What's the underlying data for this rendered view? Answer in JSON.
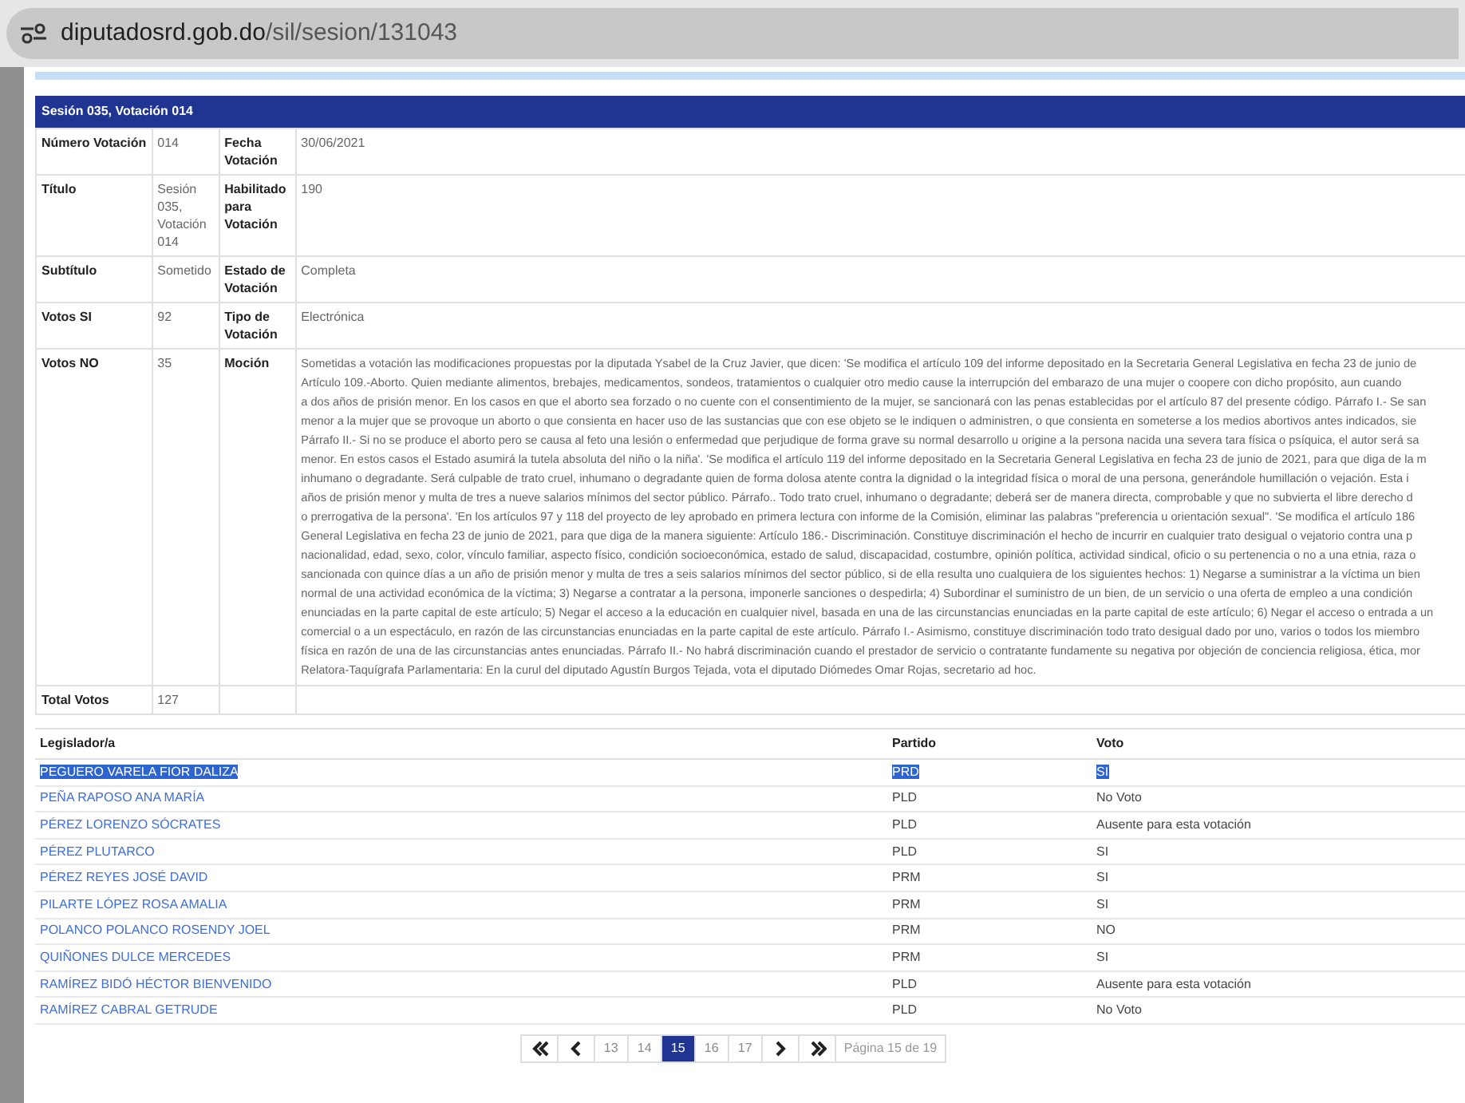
{
  "browser": {
    "url_domain": "diputadosrd.gob.do",
    "url_path": "/sil/sesion/131043"
  },
  "panel": {
    "title": "Sesión 035, Votación 014"
  },
  "details": [
    {
      "label": "Número Votación",
      "value": "014",
      "label_2": "Fecha Votación",
      "value_2": "30/06/2021"
    },
    {
      "label": "Título",
      "value": "Sesión 035, Votación 014",
      "label_2": "Habilitado para Votación",
      "value_2": "190"
    },
    {
      "label": "Subtítulo",
      "value": "Sometido",
      "label_2": "Estado de Votación",
      "value_2": "Completa"
    },
    {
      "label": "Votos SI",
      "value": "92",
      "label_2": "Tipo de Votación",
      "value_2": "Electrónica"
    },
    {
      "label": "Votos NO",
      "value": "35",
      "label_2": "Moción",
      "value_2_lines": [
        "Sometidas a votación las modificaciones propuestas por la diputada Ysabel de la Cruz Javier, que dicen: 'Se modifica el artículo 109 del informe depositado en la Secretaria General Legislativa en fecha 23 de junio de",
        "Artículo 109.-Aborto. Quien mediante alimentos, brebajes, medicamentos, sondeos, tratamientos o cualquier otro medio cause la interrupción del embarazo de una mujer o coopere con dicho propósito, aun cuando",
        "a dos años de prisión menor. En los casos en que el aborto sea forzado o no cuente con el consentimiento de la mujer, se sancionará con las penas establecidas por el artículo 87 del presente código. Párrafo I.- Se san",
        "menor a la mujer que se provoque un aborto o que consienta en hacer uso de las sustancias que con ese objeto se le indiquen o administren, o que consienta en someterse a los medios abortivos antes indicados, sie",
        "Párrafo II.- Si no se produce el aborto pero se causa al feto una lesión o enfermedad que perjudique de forma grave su normal desarrollo u origine a la persona nacida una severa tara física o psíquica, el autor será sa",
        "menor. En estos casos el Estado asumirá la tutela absoluta del niño o la niña'. 'Se modifica el artículo 119 del informe depositado en la Secretaria General Legislativa en fecha 23 de junio de 2021, para que diga de la m",
        "inhumano o degradante. Será culpable de trato cruel, inhumano o degradante quien de forma dolosa atente contra la dignidad o la integridad física o moral de una persona, generándole humillación o vejación. Esta i",
        "años de prisión menor y multa de tres a nueve salarios mínimos del sector público. Párrafo.. Todo trato cruel, inhumano o degradante; deberá ser de manera directa, comprobable y que no subvierta el libre derecho d",
        "o prerrogativa de la persona'. 'En los artículos 97 y 118 del proyecto de ley aprobado en primera lectura con informe de la Comisión, eliminar las palabras \"preferencia u orientación sexual\". 'Se modifica el artículo 186",
        "General Legislativa en fecha 23 de junio de 2021, para que diga de la manera siguiente: Artículo 186.- Discriminación. Constituye discriminación el hecho de incurrir en cualquier trato desigual o vejatorio contra una p",
        "nacionalidad, edad, sexo, color, vínculo familiar, aspecto físico, condición socioeconómica, estado de salud, discapacidad, costumbre, opinión política, actividad sindical, oficio o su pertenencia o no a una etnia, raza o",
        "sancionada con quince días a un año de prisión menor y multa de tres a seis salarios mínimos del sector público, si de ella resulta uno cualquiera de los siguientes hechos: 1) Negarse a suministrar a la víctima un bien",
        "normal de una actividad económica de la víctima; 3) Negarse a contratar a la persona, imponerle sanciones o despedirla; 4) Subordinar el suministro de un bien, de un servicio o una oferta de empleo a una condición",
        "enunciadas en la parte capital de este artículo; 5) Negar el acceso a la educación en cualquier nivel, basada en una de las circunstancias enunciadas en la parte capital de este artículo; 6) Negar el acceso o entrada a un",
        "comercial o a un espectáculo, en razón de las circunstancias enunciadas en la parte capital de este artículo. Párrafo I.- Asimismo, constituye discriminación todo trato desigual dado por uno, varios o todos los miembro",
        "física en razón de una de las circunstancias antes enunciadas. Párrafo II.- No habrá discriminación cuando el prestador de servicio o contratante fundamente su negativa por objeción de conciencia religiosa, ética, mor",
        "Relatora-Taquígrafa Parlamentaria: En la curul del diputado Agustín Burgos Tejada, vota el diputado Diómedes Omar Rojas, secretario ad hoc."
      ]
    },
    {
      "label": "Total Votos",
      "value": "127"
    }
  ],
  "votes": {
    "columns": [
      "Legislador/a",
      "Partido",
      "Voto"
    ],
    "rows": [
      {
        "name": "PEGUERO VARELA FIOR DALIZA",
        "party": "PRD",
        "vote": "SI",
        "highlighted": true
      },
      {
        "name": "PEÑA RAPOSO ANA MARÍA",
        "party": "PLD",
        "vote": "No Voto",
        "highlighted": false
      },
      {
        "name": "PÉREZ LORENZO SÓCRATES",
        "party": "PLD",
        "vote": "Ausente para esta votación",
        "highlighted": false
      },
      {
        "name": "PÉREZ PLUTARCO",
        "party": "PLD",
        "vote": "SI",
        "highlighted": false
      },
      {
        "name": "PÉREZ REYES JOSÉ DAVID",
        "party": "PRM",
        "vote": "SI",
        "highlighted": false
      },
      {
        "name": "PILARTE LÓPEZ ROSA AMALIA",
        "party": "PRM",
        "vote": "SI",
        "highlighted": false
      },
      {
        "name": "POLANCO POLANCO ROSENDY JOEL",
        "party": "PRM",
        "vote": "NO",
        "highlighted": false
      },
      {
        "name": "QUIÑONES DULCE MERCEDES",
        "party": "PRM",
        "vote": "SI",
        "highlighted": false
      },
      {
        "name": "RAMÍREZ BIDÓ HÉCTOR BIENVENIDO",
        "party": "PLD",
        "vote": "Ausente para esta votación",
        "highlighted": false
      },
      {
        "name": "RAMÍREZ CABRAL GETRUDE",
        "party": "PLD",
        "vote": "No Voto",
        "highlighted": false
      }
    ]
  },
  "pagination": [
    {
      "kind": "first"
    },
    {
      "kind": "prev"
    },
    {
      "kind": "page",
      "label": "13",
      "selected": false
    },
    {
      "kind": "page",
      "label": "14",
      "selected": false
    },
    {
      "kind": "page",
      "label": "15",
      "selected": true
    },
    {
      "kind": "page",
      "label": "16",
      "selected": false
    },
    {
      "kind": "page",
      "label": "17",
      "selected": false
    },
    {
      "kind": "next"
    },
    {
      "kind": "last"
    },
    {
      "kind": "info",
      "label": "Página 15 de 19"
    }
  ]
}
